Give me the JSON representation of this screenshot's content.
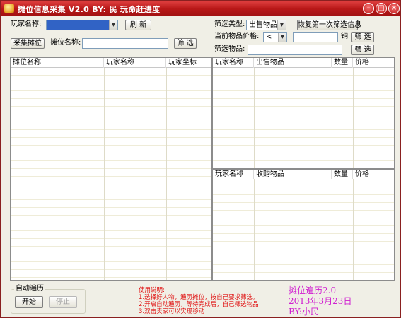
{
  "window": {
    "title": "摊位信息采集 V2.0  BY: 民  玩命赶进度",
    "min_glyph": "–",
    "max_glyph": "□",
    "close_glyph": "×"
  },
  "top_left": {
    "player_label": "玩家名称:",
    "player_value": "",
    "refresh_button": "刷 新",
    "collect_button": "采集摊位",
    "stall_label": "摊位名称:",
    "stall_value": "",
    "filter_button": "筛 选"
  },
  "top_right": {
    "filter_type_label": "筛选类型:",
    "filter_type_value": "出售物品",
    "restore_button": "恢复第一次筛选信息",
    "price_label": "当前物品价格:",
    "price_op_value": "<",
    "price_value": "",
    "price_unit": "铜",
    "price_filter_button": "筛 选",
    "item_label": "筛选物品:",
    "item_value": "",
    "item_filter_button": "筛 选"
  },
  "stall_list": {
    "columns": [
      "摊位名称",
      "玩家名称",
      "玩家坐标"
    ]
  },
  "sell_list": {
    "columns": [
      "玩家名称",
      "出售物品",
      "数量",
      "价格"
    ]
  },
  "buy_list": {
    "columns": [
      "玩家名称",
      "收购物品",
      "数量",
      "价格"
    ]
  },
  "auto_traverse": {
    "title": "自动遍历",
    "start_button": "开始",
    "stop_button": "停止"
  },
  "usage": {
    "heading": "使用说明:",
    "lines": [
      "1.选择好人物，遍历摊位，按自己要求筛选。",
      "2.开启自动遍历，等待完成后，自己筛选物品",
      "3.双击卖家可以实现移动"
    ]
  },
  "credit": {
    "line1": "摊位遍历2.0",
    "line2": "2013年3月23日",
    "line3": "BY:小民"
  },
  "colors": {
    "titlebar": "#b81818",
    "accent_selection": "#3163c5",
    "usage_text": "#e01010",
    "credit_text": "#d020d0"
  }
}
